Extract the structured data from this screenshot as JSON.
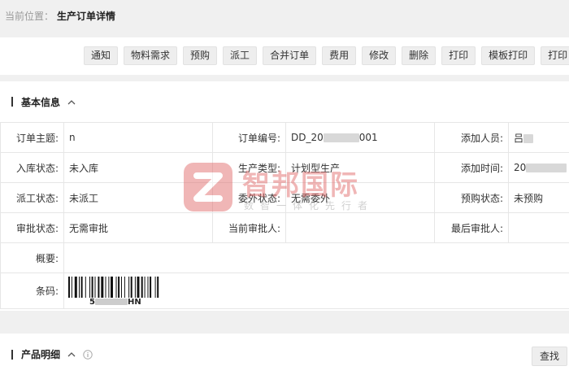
{
  "breadcrumb": {
    "label": "当前位置：",
    "current": "生产订单详情"
  },
  "toolbar": {
    "buttons": [
      {
        "label": "通知",
        "name": "notify-button"
      },
      {
        "label": "物料需求",
        "name": "material-demand-button"
      },
      {
        "label": "预购",
        "name": "pre-purchase-button"
      },
      {
        "label": "派工",
        "name": "dispatch-button"
      },
      {
        "label": "合并订单",
        "name": "merge-order-button"
      },
      {
        "label": "费用",
        "name": "cost-button"
      },
      {
        "label": "修改",
        "name": "edit-button"
      },
      {
        "label": "删除",
        "name": "delete-button"
      },
      {
        "label": "打印",
        "name": "print-button"
      },
      {
        "label": "模板打印",
        "name": "template-print-button"
      },
      {
        "label": "打印",
        "name": "print-button-2"
      }
    ]
  },
  "basic_info": {
    "title": "基本信息",
    "subject_label": "订单主题:",
    "subject_value": "n",
    "order_no_label": "订单编号:",
    "order_no_prefix": "DD_20",
    "order_no_suffix": "001",
    "adder_label": "添加人员:",
    "adder_value": "吕",
    "stock_status_label": "入库状态:",
    "stock_status_value": "未入库",
    "prod_type_label": "生产类型:",
    "prod_type_value": "计划型生产",
    "add_time_label": "添加时间:",
    "add_time_value": "20",
    "dispatch_status_label": "派工状态:",
    "dispatch_status_value": "未派工",
    "outsource_status_label": "委外状态:",
    "outsource_status_value": "无需委外",
    "prepurchase_status_label": "预购状态:",
    "prepurchase_status_value": "未预购",
    "approval_status_label": "审批状态:",
    "approval_status_value": "无需审批",
    "current_approver_label": "当前审批人:",
    "current_approver_value": "",
    "last_approver_label": "最后审批人:",
    "last_approver_value": "",
    "summary_label": "概要:",
    "summary_value": "",
    "barcode_label": "条码:",
    "barcode_text_start": "5",
    "barcode_text_end": "HN"
  },
  "product_detail": {
    "title": "产品明细",
    "find_label": "查找"
  },
  "watermark": {
    "text": "智邦国际",
    "subtext": "数智一体化先行者"
  }
}
